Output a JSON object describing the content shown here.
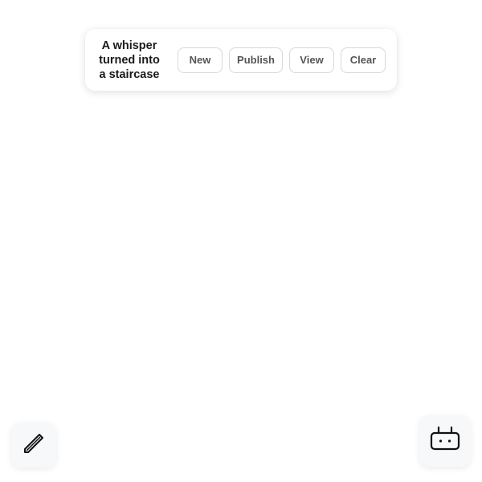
{
  "toolbar": {
    "title": "A whisper turned into a staircase",
    "buttons": {
      "new": "New",
      "publish": "Publish",
      "view": "View",
      "clear": "Clear"
    }
  },
  "floating_buttons": {
    "left_icon": "pen-icon",
    "right_icon": "robot-icon"
  },
  "colors": {
    "background": "#ffffff",
    "button_text": "#555555",
    "title_text": "#1a1a1a",
    "button_border": "#d8d8d8"
  }
}
